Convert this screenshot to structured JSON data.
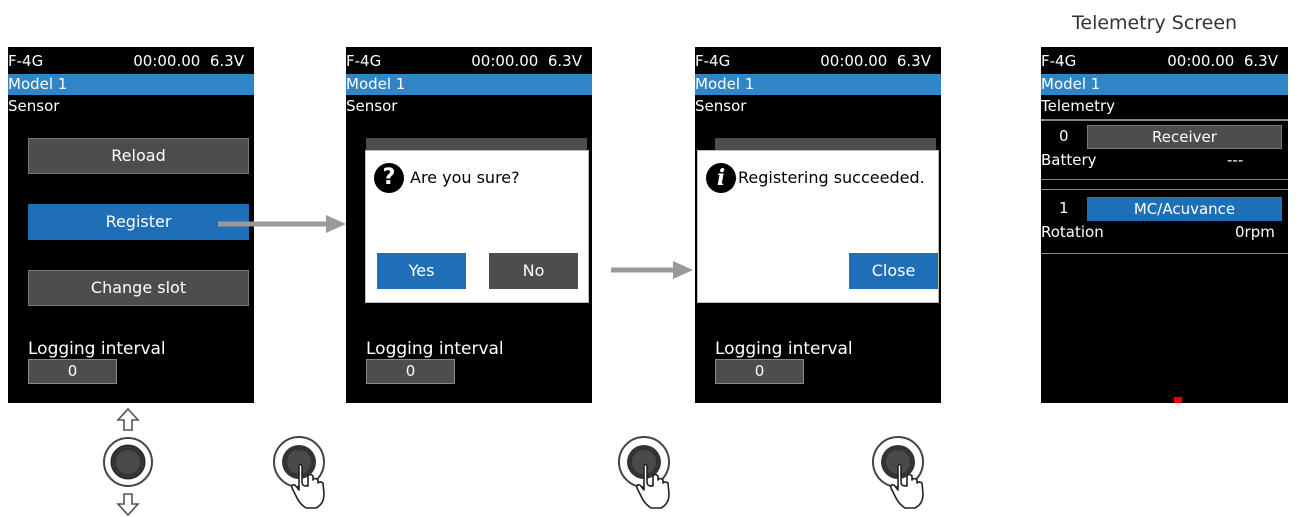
{
  "caption": "Telemetry Screen",
  "header": {
    "system": "F-4G",
    "timer": "00:00.00",
    "voltage": "6.3V",
    "model": "Model 1"
  },
  "sensor_screen": {
    "title": "Sensor",
    "reload_label": "Reload",
    "register_label": "Register",
    "change_slot_label": "Change slot",
    "logging_label": "Logging interval",
    "logging_value": "0"
  },
  "confirm_dialog": {
    "message": "Are you sure?",
    "yes_label": "Yes",
    "no_label": "No",
    "icon_glyph": "?"
  },
  "success_dialog": {
    "message": "Registering succeeded.",
    "close_label": "Close",
    "icon_glyph": "i"
  },
  "telemetry": {
    "title": "Telemetry",
    "slot0": {
      "index": "0",
      "name": "Receiver",
      "item": "Battery",
      "value": "---"
    },
    "slot1": {
      "index": "1",
      "name": "MC/Acuvance",
      "item": "Rotation",
      "value": "0rpm"
    }
  },
  "controls": {
    "scroll_icon": "up-down-arrows-icon",
    "press_icon": "hand-press-icon"
  },
  "colors": {
    "accent": "#2e86c8",
    "button": "#4d4d4d",
    "screen": "#000000"
  }
}
